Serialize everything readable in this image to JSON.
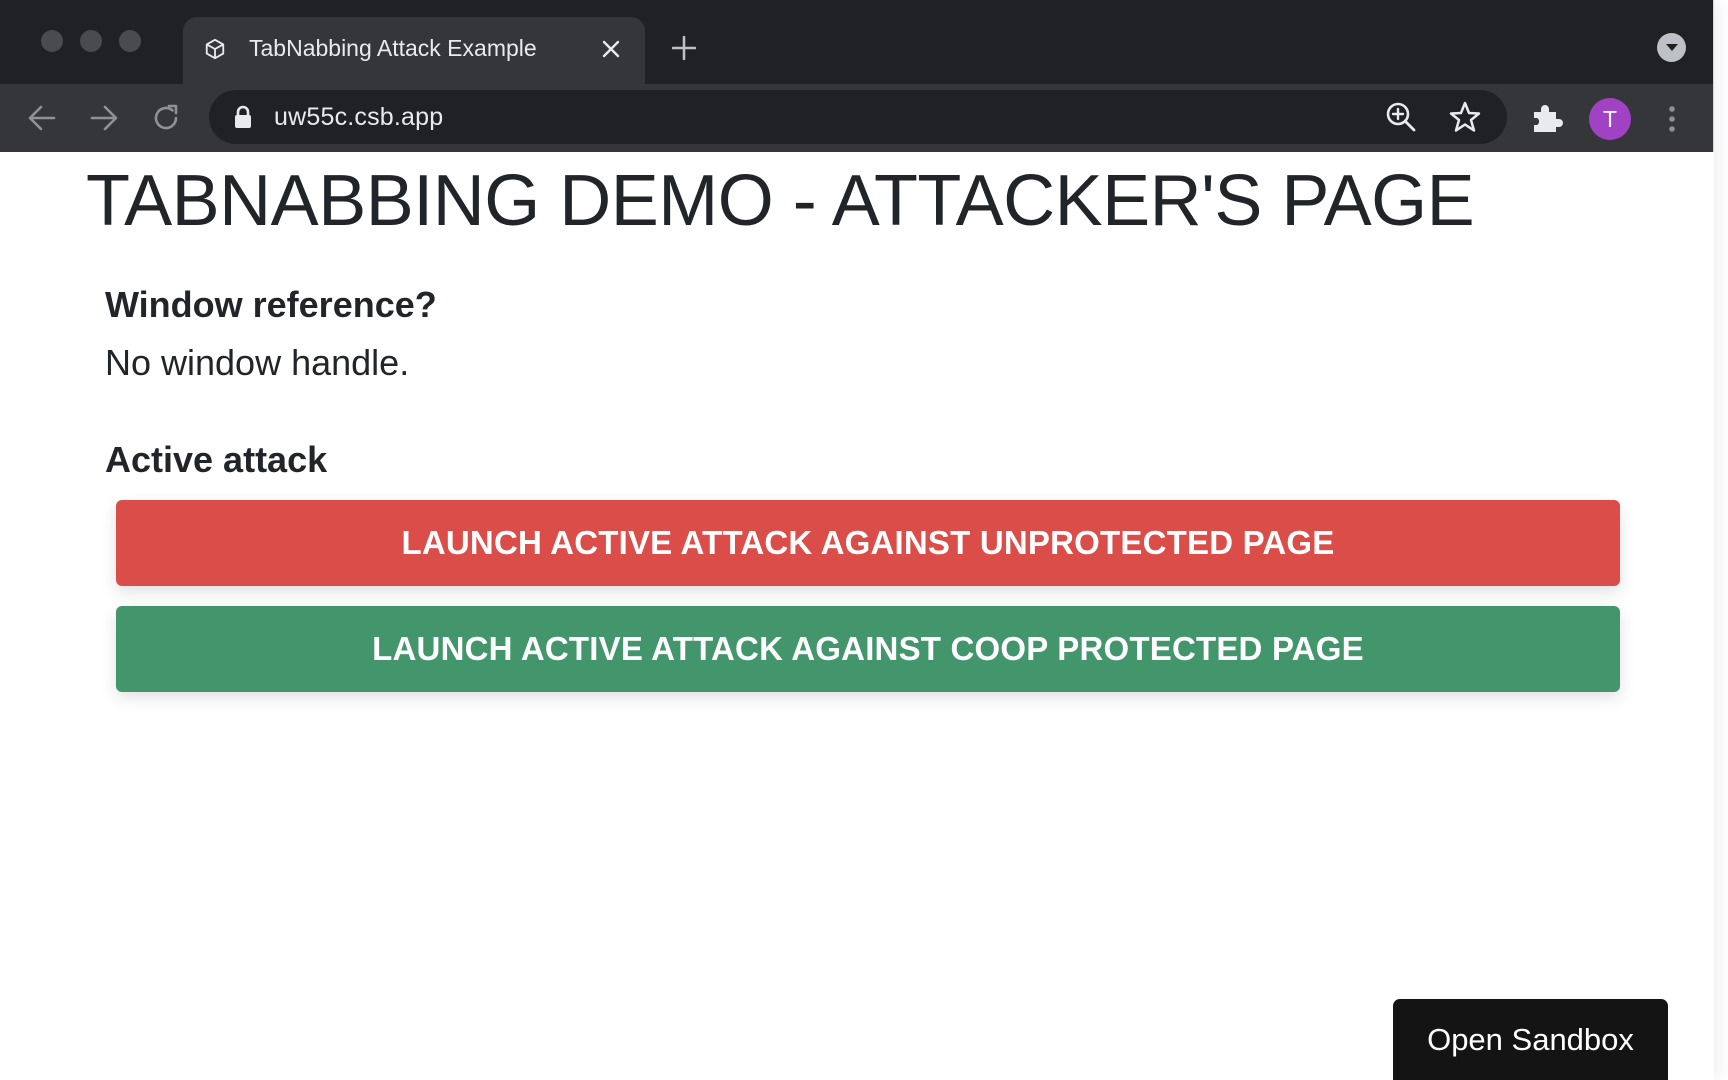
{
  "browser": {
    "tab": {
      "title": "TabNabbing Attack Example",
      "favicon": "codesandbox-cube-icon"
    },
    "address_bar": {
      "url": "uw55c.csb.app",
      "security": "lock-icon"
    },
    "profile_initial": "T",
    "profile_color": "#a142c4"
  },
  "page": {
    "title": "TABNABBING DEMO - ATTACKER'S PAGE",
    "window_reference": {
      "heading": "Window reference?",
      "value": "No window handle."
    },
    "active_attack": {
      "heading": "Active attack",
      "unprotected_button": "LAUNCH ACTIVE ATTACK AGAINST UNPROTECTED PAGE",
      "coop_button": "LAUNCH ACTIVE ATTACK AGAINST COOP PROTECTED PAGE"
    }
  },
  "sandbox_button": "Open Sandbox",
  "colors": {
    "danger": "#db4d49",
    "success": "#43956c",
    "chrome_dark": "#202124",
    "chrome_toolbar": "#35363a"
  }
}
